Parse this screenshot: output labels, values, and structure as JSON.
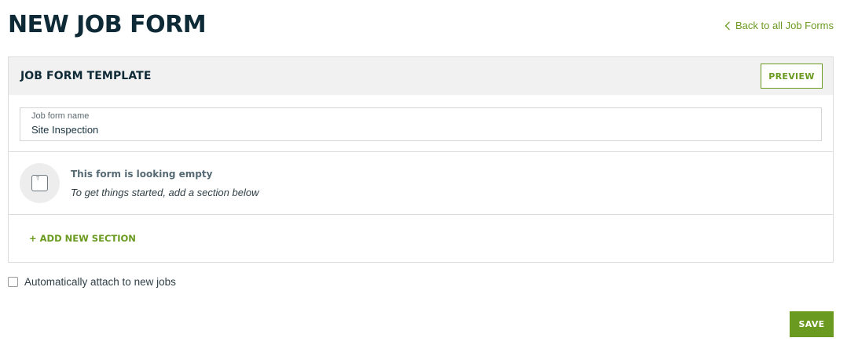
{
  "header": {
    "title": "NEW JOB FORM",
    "back_link": "Back to all Job Forms",
    "back_icon": "chevron-left-icon"
  },
  "card": {
    "title": "JOB FORM TEMPLATE",
    "preview_label": "PREVIEW",
    "name_field": {
      "label": "Job form name",
      "value": "Site Inspection"
    },
    "empty_state": {
      "icon": "text-box-icon",
      "icon_glyph": "T",
      "title": "This form is looking empty",
      "subtitle": "To get things started, add a section below"
    },
    "add_section_label": "+ ADD NEW SECTION"
  },
  "attach_option": {
    "label": "Automatically attach to new jobs",
    "checked": false
  },
  "save_label": "SAVE",
  "colors": {
    "accent": "#6a9a1f",
    "title": "#0f2a37",
    "header_bg": "#f1f1f1",
    "border": "#dcdcdc"
  }
}
